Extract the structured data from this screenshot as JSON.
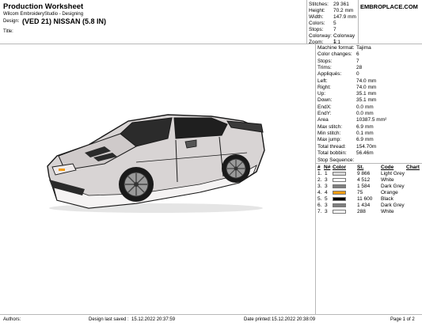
{
  "header": {
    "title": "Production Worksheet",
    "subtitle": "Wilcom EmbroideryStudio - Designing",
    "design_label": "Design:",
    "design_value": "(VED 21) NISSAN (5.8 IN)",
    "title_label": "Title:"
  },
  "top_info": [
    {
      "label": "Stitches:",
      "value": "29 361"
    },
    {
      "label": "Height:",
      "value": "70.2 mm"
    },
    {
      "label": "Width:",
      "value": "147.9 mm"
    },
    {
      "label": "Colors:",
      "value": "5"
    },
    {
      "label": "Stops:",
      "value": "7"
    },
    {
      "label": "Colorway:",
      "value": "Colorway 1"
    },
    {
      "label": "Zoom:",
      "value": "1:1"
    }
  ],
  "brand": "EMBROPLACE.COM",
  "machine_info": [
    {
      "label": "Machine format:",
      "value": "Tajima"
    },
    {
      "label": "Color changes:",
      "value": "6"
    },
    {
      "label": "Stops:",
      "value": "7"
    },
    {
      "label": "Trims:",
      "value": "28"
    },
    {
      "label": "Appliqués:",
      "value": "0"
    },
    {
      "label": "Left:",
      "value": "74.0 mm"
    },
    {
      "label": "Right:",
      "value": "74.0 mm"
    },
    {
      "label": "Up:",
      "value": "35.1 mm"
    },
    {
      "label": "Down:",
      "value": "35.1 mm"
    },
    {
      "label": "EndX:",
      "value": "0.0 mm"
    },
    {
      "label": "EndY:",
      "value": "0.0 mm"
    },
    {
      "label": "Area",
      "value": "10387.5 mm²"
    },
    {
      "label": "Max stitch:",
      "value": "6.9 mm"
    },
    {
      "label": "Min stitch:",
      "value": "0.1 mm"
    },
    {
      "label": "Max jump:",
      "value": "6.9 mm"
    },
    {
      "label": "Total thread:",
      "value": "154.70m"
    },
    {
      "label": "Total bobbin:",
      "value": "56.46m"
    }
  ],
  "stop_sequence": {
    "title": "Stop Sequence:",
    "headers": {
      "num": "#",
      "n": "N#",
      "color": "Color",
      "st": "St.",
      "code": "Code",
      "chart": "Chart"
    },
    "rows": [
      {
        "num": "1.",
        "n": "1",
        "st": "9 866",
        "code": "Light Grey",
        "color": "#d9d9d9"
      },
      {
        "num": "2.",
        "n": "3",
        "st": "4 512",
        "code": "White",
        "color": "#ffffff"
      },
      {
        "num": "3.",
        "n": "3",
        "st": "1 584",
        "code": "Dark Grey",
        "color": "#7f7f7f"
      },
      {
        "num": "4.",
        "n": "4",
        "st": "75",
        "code": "Orange",
        "color": "#f39c12"
      },
      {
        "num": "5.",
        "n": "5",
        "st": "11 600",
        "code": "Black",
        "color": "#000000"
      },
      {
        "num": "6.",
        "n": "3",
        "st": "1 434",
        "code": "Dark Grey",
        "color": "#7f7f7f"
      },
      {
        "num": "7.",
        "n": "3",
        "st": "288",
        "code": "White",
        "color": "#ffffff"
      }
    ]
  },
  "footer": {
    "authors": "Authors:",
    "saved_label": "Design last saved :",
    "saved_value": "15.12.2022 20:37:59",
    "printed_label": "Date printed:",
    "printed_value": "15.12.2022 20:38:09",
    "page": "Page 1 of 2"
  }
}
